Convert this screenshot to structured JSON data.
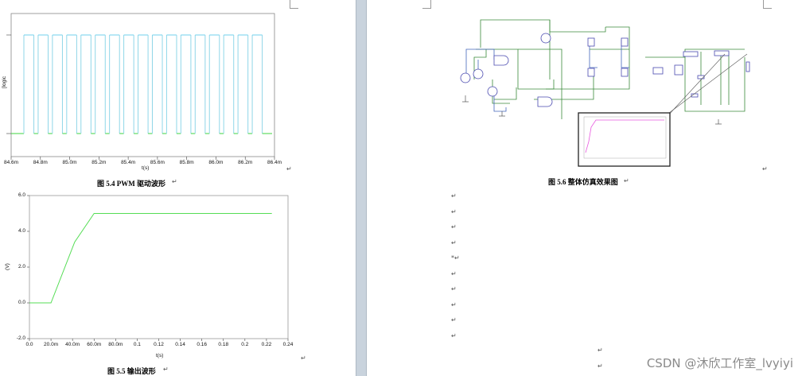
{
  "figure_5_4": {
    "caption": "图 5.4 PWM 驱动波形",
    "y_label": "[logic",
    "x_label": "t(s)",
    "x_ticks": [
      "84.6m",
      "84.8m",
      "85.0m",
      "85.2m",
      "85.4m",
      "85.6m",
      "85.8m",
      "86.0m",
      "86.2m",
      "86.4m"
    ],
    "high_color": "#6fd0ee",
    "low_color": "#3fd63f",
    "pulses": 17
  },
  "figure_5_5": {
    "caption": "图 5.5  输出波形",
    "y_label": "(V)",
    "x_label": "t(s)",
    "y_ticks": [
      "6.0",
      "4.0",
      "2.0",
      "0.0",
      "-2.0"
    ],
    "x_ticks": [
      "0.0",
      "20.0m",
      "40.0m",
      "60.0m",
      "80.0m",
      "0.1",
      "0.12",
      "0.14",
      "0.16",
      "0.18",
      "0.2",
      "0.22",
      "0.24"
    ],
    "line_color": "#55dd55"
  },
  "figure_5_6": {
    "caption": "图 5.6  整体仿真效果图",
    "inset_line_color": "#e85adf"
  },
  "chart_data": [
    {
      "type": "line",
      "title": "",
      "xlabel": "t(s)",
      "ylabel": "[logic",
      "x_range": [
        "84.6m",
        "86.4m"
      ],
      "note_series": "square wave PWM, high level cyan, low level green"
    },
    {
      "type": "line",
      "title": "",
      "xlabel": "t(s)",
      "ylabel": "(V)",
      "xlim": [
        0,
        0.24
      ],
      "ylim": [
        -2,
        6
      ],
      "x": [
        0,
        0.02,
        0.042,
        0.06,
        0.225
      ],
      "y": [
        0,
        0,
        3.4,
        5.0,
        5.0
      ]
    }
  ],
  "paragraph_marks": [
    "↵",
    "↵",
    "↵",
    "↵",
    "*↵",
    "↵",
    "↵",
    "↵",
    "↵",
    "↵"
  ],
  "watermark": "CSDN @沐欣工作室_lvyiyi"
}
